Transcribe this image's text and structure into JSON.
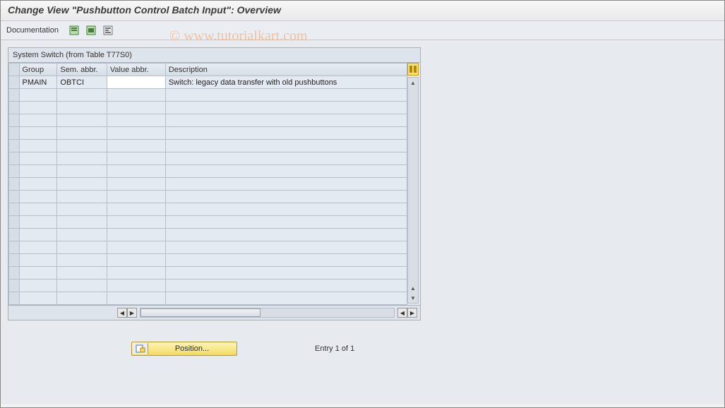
{
  "header": {
    "title": "Change View \"Pushbutton Control Batch Input\": Overview"
  },
  "toolbar": {
    "documentation_label": "Documentation"
  },
  "panel": {
    "title": "System Switch (from Table T77S0)"
  },
  "columns": {
    "group": "Group",
    "sem_abbr": "Sem. abbr.",
    "value_abbr": "Value abbr.",
    "description": "Description"
  },
  "rows": [
    {
      "group": "PMAIN",
      "sem": "OBTCI",
      "val": "",
      "desc": "Switch: legacy data transfer with old pushbuttons"
    }
  ],
  "footer": {
    "position_label": "Position...",
    "entry_text": "Entry 1 of 1"
  },
  "watermark": "© www.tutorialkart.com"
}
